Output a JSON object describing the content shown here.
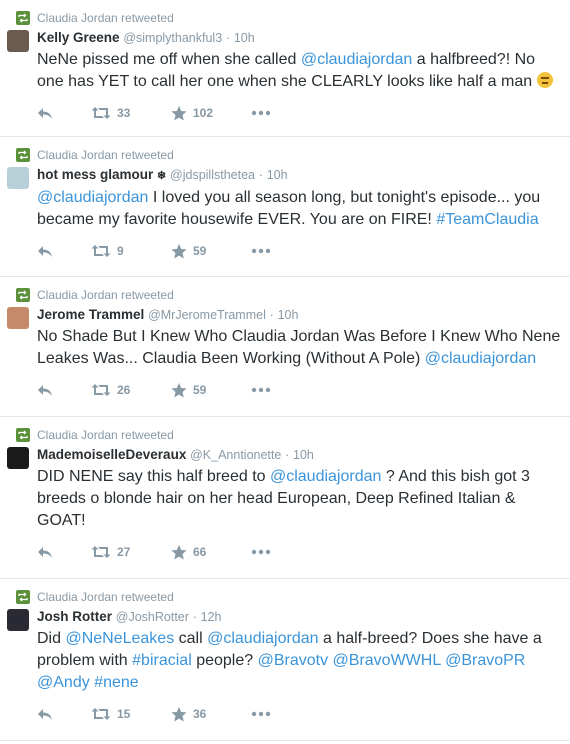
{
  "retweeted_by": "Claudia Jordan retweeted",
  "tweets": [
    {
      "name": "Kelly Greene",
      "handle": "@simplythankful3",
      "time": "10h",
      "text_parts": [
        "NeNe pissed me off when she called ",
        "@claudiajordan",
        "  a halfbreed?! No one has YET to call her one when she CLEARLY looks like half a man "
      ],
      "retweets": "33",
      "favorites": "102",
      "avatar_color": "#6b5a4e"
    },
    {
      "name": "hot mess glamour",
      "name_suffix": "❄",
      "handle": "@jdspillsthetea",
      "time": "10h",
      "text_parts": [
        "@claudiajordan",
        " I loved you all season long, but tonight's episode... you became my favorite housewife EVER. You are on FIRE! ",
        "#TeamClaudia"
      ],
      "retweets": "9",
      "favorites": "59",
      "avatar_color": "#b7d0d8"
    },
    {
      "name": "Jerome Trammel",
      "handle": "@MrJeromeTrammel",
      "time": "10h",
      "text_parts": [
        "No Shade But I Knew Who Claudia Jordan Was Before I Knew Who Nene Leakes Was... Claudia Been Working (Without A Pole) ",
        "@claudiajordan"
      ],
      "retweets": "26",
      "favorites": "59",
      "avatar_color": "#c58a6a"
    },
    {
      "name": "MademoiselleDeveraux",
      "handle": "@K_Anntionette",
      "time": "10h",
      "text_parts": [
        "DID NENE say this half breed to ",
        "@claudiajordan",
        " ? And this bish got 3 breeds o blonde hair on her head European, Deep Refined Italian & GOAT!"
      ],
      "retweets": "27",
      "favorites": "66",
      "avatar_color": "#1a1a1a"
    },
    {
      "name": "Josh Rotter",
      "handle": "@JoshRotter",
      "time": "12h",
      "text_parts": [
        "Did ",
        "@NeNeLeakes",
        " call ",
        "@claudiajordan",
        " a half-breed? Does she have a problem with ",
        "#biracial",
        " people? ",
        "@Bravotv",
        " ",
        "@BravoWWHL",
        " ",
        "@BravoPR",
        " ",
        "@Andy",
        " ",
        "#nene"
      ],
      "retweets": "15",
      "favorites": "36",
      "avatar_color": "#2a2a35"
    }
  ],
  "colors": {
    "link": "#3b94d9",
    "retweet_green": "#5c913b",
    "muted": "#8899a6",
    "text": "#292f33"
  }
}
